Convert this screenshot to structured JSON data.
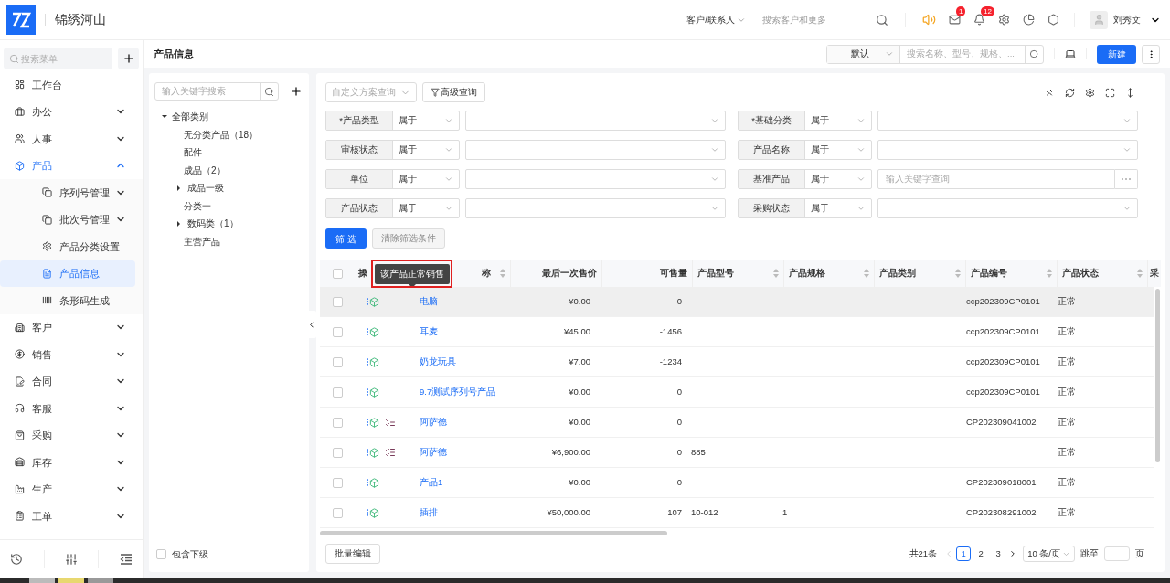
{
  "header": {
    "app_name": "锦绣河山",
    "search_scope": "客户/联系人",
    "search_placeholder": "搜索客户和更多",
    "message_count": "1",
    "notice_count": "12",
    "user_name": "刘秀文"
  },
  "sidebar": {
    "search_placeholder": "搜索菜单",
    "items": [
      {
        "label": "工作台",
        "kind": "link",
        "selected": false
      },
      {
        "label": "办公",
        "kind": "group",
        "expanded": false,
        "selected": false
      },
      {
        "label": "人事",
        "kind": "group",
        "expanded": false,
        "selected": false
      },
      {
        "label": "产品",
        "kind": "group",
        "expanded": true,
        "selected": true,
        "children": [
          {
            "label": "序列号管理",
            "kind": "group",
            "expanded": false,
            "selected": false
          },
          {
            "label": "批次号管理",
            "kind": "group",
            "expanded": false,
            "selected": false
          },
          {
            "label": "产品分类设置",
            "kind": "link",
            "selected": false
          },
          {
            "label": "产品信息",
            "kind": "link",
            "selected": true
          },
          {
            "label": "条形码生成",
            "kind": "link",
            "selected": false
          }
        ]
      },
      {
        "label": "客户",
        "kind": "group",
        "expanded": false,
        "selected": false
      },
      {
        "label": "销售",
        "kind": "group",
        "expanded": false,
        "selected": false
      },
      {
        "label": "合同",
        "kind": "group",
        "expanded": false,
        "selected": false
      },
      {
        "label": "客服",
        "kind": "group",
        "expanded": false,
        "selected": false
      },
      {
        "label": "采购",
        "kind": "group",
        "expanded": false,
        "selected": false
      },
      {
        "label": "库存",
        "kind": "group",
        "expanded": false,
        "selected": false
      },
      {
        "label": "生产",
        "kind": "group",
        "expanded": false,
        "selected": false
      },
      {
        "label": "工单",
        "kind": "group",
        "expanded": false,
        "selected": false
      }
    ]
  },
  "page": {
    "title": "产品信息",
    "view_select": "默认",
    "search_placeholder": "搜索名称、型号、规格、...",
    "new_button": "新建"
  },
  "tree": {
    "search_placeholder": "输入关键字搜索",
    "nodes": [
      {
        "label": "全部类别",
        "expanded": true,
        "children": [
          {
            "label": "无分类产品（18）"
          },
          {
            "label": "配件"
          },
          {
            "label": "成品（2）"
          },
          {
            "label": "成品一级",
            "expanded": false
          },
          {
            "label": "分类一"
          },
          {
            "label": "数码类（1）",
            "expanded": false
          },
          {
            "label": "主营产品"
          }
        ]
      }
    ],
    "include_children": {
      "label": "包含下级",
      "checked": false
    }
  },
  "filter": {
    "scheme_placeholder": "自定义方案查询",
    "advanced_button": "高级查询",
    "fields": [
      {
        "label": "*产品类型",
        "operator": "属于",
        "kind": "select"
      },
      {
        "label": "*基础分类",
        "operator": "属于",
        "kind": "select"
      },
      {
        "label": "审核状态",
        "operator": "属于",
        "kind": "select"
      },
      {
        "label": "产品名称",
        "operator": "属于",
        "kind": "select"
      },
      {
        "label": "单位",
        "operator": "属于",
        "kind": "select"
      },
      {
        "label": "基准产品",
        "operator": "属于",
        "kind": "lookup",
        "placeholder": "输入关键字查询"
      },
      {
        "label": "产品状态",
        "operator": "属于",
        "kind": "select"
      },
      {
        "label": "采购状态",
        "operator": "属于",
        "kind": "select"
      }
    ],
    "apply_button": "筛 选",
    "clear_button": {
      "label": "清除筛选条件",
      "disabled": true
    }
  },
  "table": {
    "all_checked": false,
    "columns": [
      {
        "label": "操"
      },
      {
        "label": "称",
        "sortable": true
      },
      {
        "label": "最后一次售价",
        "sortable": false
      },
      {
        "label": "可售量",
        "sortable": false
      },
      {
        "label": "产品型号",
        "sortable": true
      },
      {
        "label": "产品规格",
        "sortable": true
      },
      {
        "label": "产品类别",
        "sortable": true
      },
      {
        "label": "产品编号",
        "sortable": true
      },
      {
        "label": "产品状态",
        "sortable": true
      },
      {
        "label": "采"
      }
    ],
    "rows": [
      {
        "hovered": true,
        "checked": false,
        "batch": false,
        "name": "电脑",
        "price": "¥0.00",
        "available": "0",
        "model": "",
        "spec": "",
        "code": "ccp202309CP0101",
        "status": "正常"
      },
      {
        "hovered": false,
        "checked": false,
        "batch": false,
        "name": "耳麦",
        "price": "¥45.00",
        "available": "-1456",
        "model": "",
        "spec": "",
        "code": "ccp202309CP0101",
        "status": "正常"
      },
      {
        "hovered": false,
        "checked": false,
        "batch": false,
        "name": "奶龙玩具",
        "price": "¥7.00",
        "available": "-1234",
        "model": "",
        "spec": "",
        "code": "ccp202309CP0101",
        "status": "正常"
      },
      {
        "hovered": false,
        "checked": false,
        "batch": false,
        "name": "9.7测试序列号产品",
        "price": "¥0.00",
        "available": "0",
        "model": "",
        "spec": "",
        "code": "ccp202309CP0101",
        "status": "正常"
      },
      {
        "hovered": false,
        "checked": false,
        "batch": true,
        "name": "阿萨德",
        "price": "¥0.00",
        "available": "0",
        "model": "",
        "spec": "",
        "code": "CP202309041002",
        "status": "正常"
      },
      {
        "hovered": false,
        "checked": false,
        "batch": true,
        "name": "阿萨德",
        "price": "¥6,900.00",
        "available": "0",
        "model": "885",
        "spec": "",
        "code": "",
        "status": "正常"
      },
      {
        "hovered": false,
        "checked": false,
        "batch": false,
        "name": "产品1",
        "price": "¥0.00",
        "available": "0",
        "model": "",
        "spec": "",
        "code": "CP202309018001",
        "status": "正常"
      },
      {
        "hovered": false,
        "checked": false,
        "batch": false,
        "name": "插排",
        "price": "¥50,000.00",
        "available": "107",
        "model": "10-012",
        "spec": "1",
        "code": "CP202308291002",
        "status": "正常"
      }
    ],
    "tooltip": "该产品正常销售"
  },
  "footer": {
    "batch_edit": "批量编辑",
    "total": "共21条",
    "pages": [
      {
        "label": "1",
        "selected": true
      },
      {
        "label": "2",
        "selected": false
      },
      {
        "label": "3",
        "selected": false
      }
    ],
    "page_size": "10 条/页",
    "jump_label": "跳至",
    "page_suffix": "页"
  }
}
